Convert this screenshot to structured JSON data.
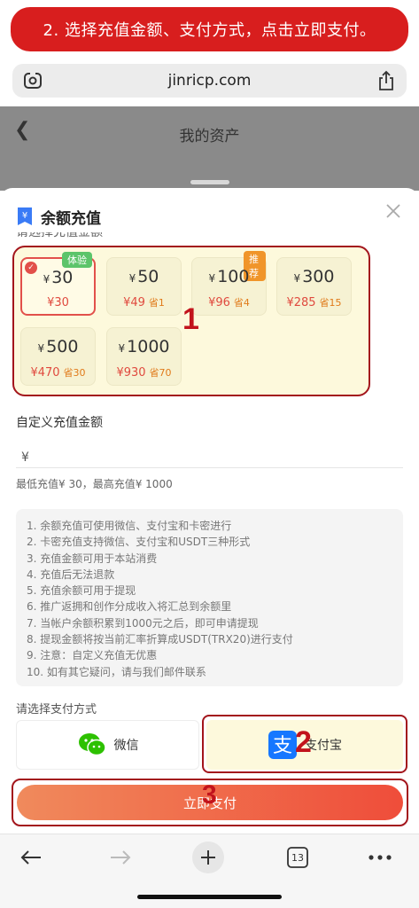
{
  "banner": {
    "text": "2. 选择充值金额、支付方式，点击立即支付。"
  },
  "browser": {
    "url": "jinricp.com",
    "tab_count": "13"
  },
  "page": {
    "title": "我的资产"
  },
  "sheet": {
    "title": "余额充值",
    "partial_label": "请选择充值金额",
    "amounts": [
      {
        "label": "30",
        "price": "¥30",
        "save": "",
        "tag": "体验",
        "selected": true
      },
      {
        "label": "50",
        "price": "¥49",
        "save": "省1",
        "tag": ""
      },
      {
        "label": "100",
        "price": "¥96",
        "save": "省4",
        "tag": "推荐"
      },
      {
        "label": "300",
        "price": "¥285",
        "save": "省15",
        "tag": ""
      },
      {
        "label": "500",
        "price": "¥470",
        "save": "省30",
        "tag": ""
      },
      {
        "label": "1000",
        "price": "¥930",
        "save": "省70",
        "tag": ""
      }
    ],
    "currency_symbol": "¥",
    "custom_label": "自定义充值金额",
    "custom_input_currency": "¥",
    "limit_text": "最低充值¥ 30，最高充值¥ 1000",
    "notes": [
      "1. 余额充值可使用微信、支付宝和卡密进行",
      "2. 卡密充值支持微信、支付宝和USDT三种形式",
      "3. 充值金额可用于本站消费",
      "4. 充值后无法退款",
      "5. 充值余额可用于提现",
      "6. 推广返拥和创作分成收入将汇总到余额里",
      "7. 当帐户余额积累到1000元之后，即可申请提现",
      "8. 提现金额将按当前汇率折算成USDT(TRX20)进行支付",
      "9. 注意：自定义充值无优惠",
      "10. 如有其它疑问，请与我们邮件联系"
    ],
    "pay_label": "请选择支付方式",
    "pay_wechat": "微信",
    "pay_alipay": "支付宝",
    "submit": "立即支付"
  },
  "annotations": {
    "step1": "1",
    "step2": "2",
    "step3": "3"
  },
  "colors": {
    "banner": "#d81e1e",
    "outline": "#a3151c",
    "accent": "#e2504a",
    "tag_green": "#5cc46a",
    "tag_orange": "#f0952a",
    "wechat": "#2dc100",
    "alipay": "#1677ff"
  },
  "icons": [
    "lens-icon",
    "share-icon",
    "back-arrow-icon",
    "wallet-icon",
    "close-icon",
    "check-icon",
    "wechat-icon",
    "alipay-icon",
    "nav-back-icon",
    "nav-forward-icon",
    "new-tab-icon",
    "tabs-icon",
    "more-icon"
  ]
}
